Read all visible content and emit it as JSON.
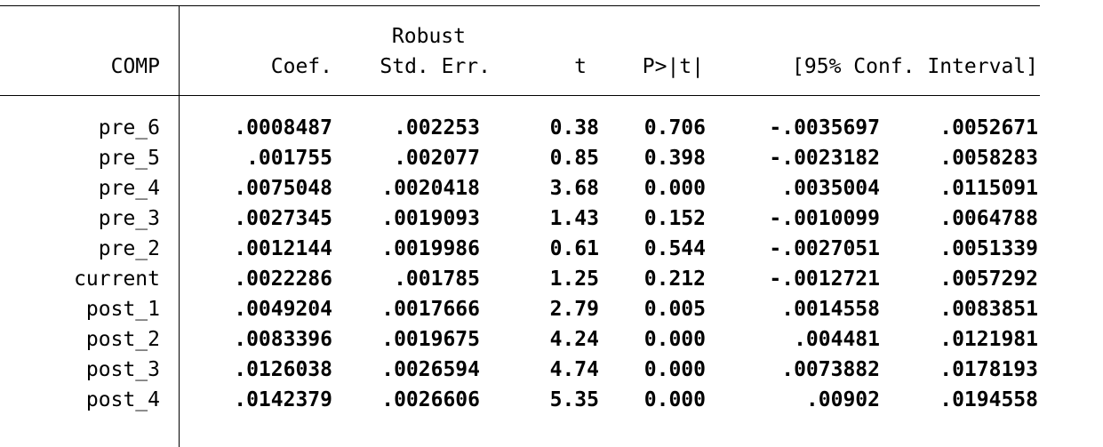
{
  "header": {
    "robust": "Robust",
    "depvar": "COMP",
    "coef": "Coef.",
    "stderr": "Std. Err.",
    "t": "t",
    "p": "P>|t|",
    "ci": "[95% Conf. Interval]"
  },
  "rows": [
    {
      "name": "pre_6",
      "coef": ".0008487",
      "se": ".002253",
      "t": "0.38",
      "p": "0.706",
      "lo": "-.0035697",
      "hi": ".0052671"
    },
    {
      "name": "pre_5",
      "coef": ".001755",
      "se": ".002077",
      "t": "0.85",
      "p": "0.398",
      "lo": "-.0023182",
      "hi": ".0058283"
    },
    {
      "name": "pre_4",
      "coef": ".0075048",
      "se": ".0020418",
      "t": "3.68",
      "p": "0.000",
      "lo": ".0035004",
      "hi": ".0115091"
    },
    {
      "name": "pre_3",
      "coef": ".0027345",
      "se": ".0019093",
      "t": "1.43",
      "p": "0.152",
      "lo": "-.0010099",
      "hi": ".0064788"
    },
    {
      "name": "pre_2",
      "coef": ".0012144",
      "se": ".0019986",
      "t": "0.61",
      "p": "0.544",
      "lo": "-.0027051",
      "hi": ".0051339"
    },
    {
      "name": "current",
      "coef": ".0022286",
      "se": ".001785",
      "t": "1.25",
      "p": "0.212",
      "lo": "-.0012721",
      "hi": ".0057292"
    },
    {
      "name": "post_1",
      "coef": ".0049204",
      "se": ".0017666",
      "t": "2.79",
      "p": "0.005",
      "lo": ".0014558",
      "hi": ".0083851"
    },
    {
      "name": "post_2",
      "coef": ".0083396",
      "se": ".0019675",
      "t": "4.24",
      "p": "0.000",
      "lo": ".004481",
      "hi": ".0121981"
    },
    {
      "name": "post_3",
      "coef": ".0126038",
      "se": ".0026594",
      "t": "4.74",
      "p": "0.000",
      "lo": ".0073882",
      "hi": ".0178193"
    },
    {
      "name": "post_4",
      "coef": ".0142379",
      "se": ".0026606",
      "t": "5.35",
      "p": "0.000",
      "lo": ".00902",
      "hi": ".0194558"
    }
  ]
}
